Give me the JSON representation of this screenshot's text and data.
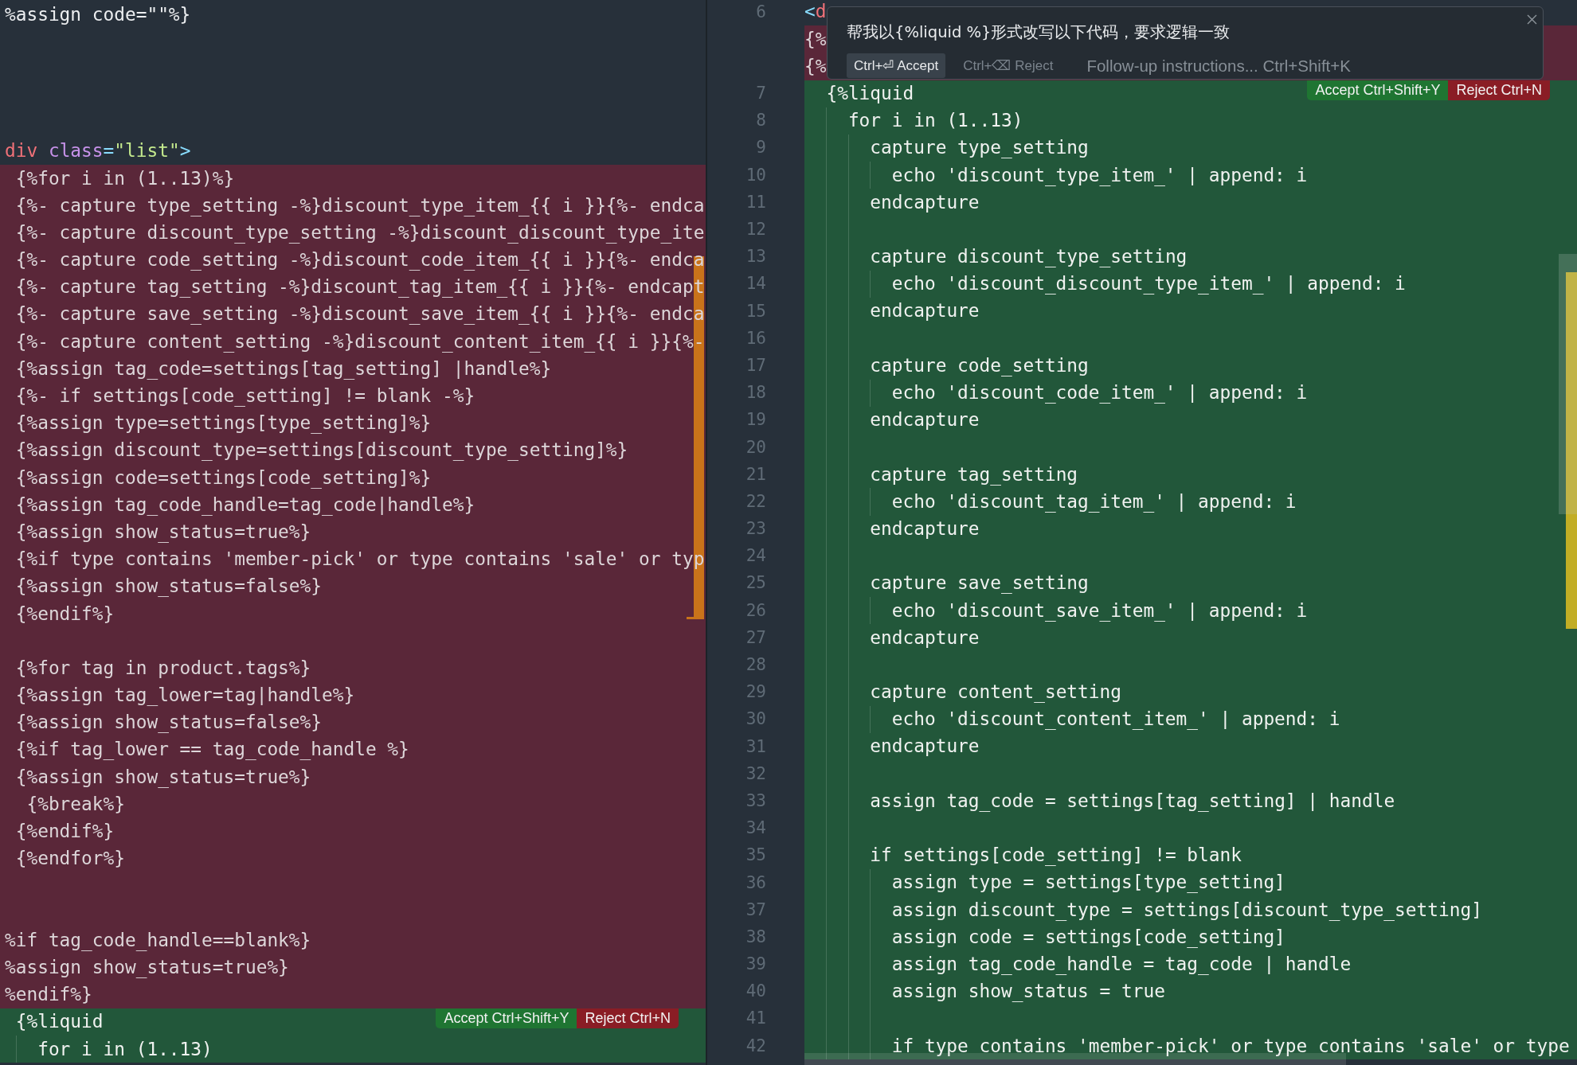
{
  "left_editor": {
    "lines": [
      {
        "kind": "context",
        "text": "%assign code=\"\"%}"
      },
      {
        "kind": "context"
      },
      {
        "kind": "context"
      },
      {
        "kind": "context"
      },
      {
        "kind": "context"
      },
      {
        "kind": "context",
        "tokens": [
          {
            "text": "div",
            "color": "#f07178"
          },
          {
            "text": " class",
            "color": "#c792ea"
          },
          {
            "text": "=",
            "color": "#89ddff"
          },
          {
            "text": "\"list\"",
            "color": "#c3e88d"
          },
          {
            "text": ">",
            "color": "#89ddff"
          }
        ]
      },
      {
        "kind": "removed",
        "text": " {%for i in (1..13)%}"
      },
      {
        "kind": "removed",
        "text": " {%- capture type_setting -%}discount_type_item_{{ i }}{%- endca"
      },
      {
        "kind": "removed",
        "text": " {%- capture discount_type_setting -%}discount_discount_type_ite"
      },
      {
        "kind": "removed",
        "text": " {%- capture code_setting -%}discount_code_item_{{ i }}{%- endca"
      },
      {
        "kind": "removed",
        "text": " {%- capture tag_setting -%}discount_tag_item_{{ i }}{%- endcapt"
      },
      {
        "kind": "removed",
        "text": " {%- capture save_setting -%}discount_save_item_{{ i }}{%- endca"
      },
      {
        "kind": "removed",
        "text": " {%- capture content_setting -%}discount_content_item_{{ i }}{%-"
      },
      {
        "kind": "removed",
        "text": " {%assign tag_code=settings[tag_setting] |handle%}"
      },
      {
        "kind": "removed",
        "text": " {%- if settings[code_setting] != blank -%}"
      },
      {
        "kind": "removed",
        "text": " {%assign type=settings[type_setting]%}"
      },
      {
        "kind": "removed",
        "text": " {%assign discount_type=settings[discount_type_setting]%}"
      },
      {
        "kind": "removed",
        "text": " {%assign code=settings[code_setting]%}"
      },
      {
        "kind": "removed",
        "text": " {%assign tag_code_handle=tag_code|handle%}"
      },
      {
        "kind": "removed",
        "text": " {%assign show_status=true%}"
      },
      {
        "kind": "removed",
        "text": " {%if type contains 'member-pick' or type contains 'sale' or typ"
      },
      {
        "kind": "removed",
        "text": " {%assign show_status=false%}"
      },
      {
        "kind": "removed",
        "text": " {%endif%}"
      },
      {
        "kind": "removed"
      },
      {
        "kind": "removed",
        "text": " {%for tag in product.tags%}"
      },
      {
        "kind": "removed",
        "text": " {%assign tag_lower=tag|handle%}"
      },
      {
        "kind": "removed",
        "text": " {%assign show_status=false%}"
      },
      {
        "kind": "removed",
        "text": " {%if tag_lower == tag_code_handle %}"
      },
      {
        "kind": "removed",
        "text": " {%assign show_status=true%}"
      },
      {
        "kind": "removed",
        "text": "  {%break%}"
      },
      {
        "kind": "removed",
        "text": " {%endif%}"
      },
      {
        "kind": "removed",
        "text": " {%endfor%}"
      },
      {
        "kind": "removed"
      },
      {
        "kind": "removed"
      },
      {
        "kind": "removed",
        "text": "%if tag_code_handle==blank%}"
      },
      {
        "kind": "removed",
        "text": "%assign show_status=true%}"
      },
      {
        "kind": "removed",
        "text": "%endif%}"
      },
      {
        "kind": "added",
        "text": " {%liquid",
        "actions": {
          "accept": "Accept Ctrl+Shift+Y",
          "reject": "Reject Ctrl+N"
        }
      },
      {
        "kind": "added",
        "text": "   for i in (1..13)"
      }
    ]
  },
  "right_editor": {
    "lines": [
      {
        "kind": "context",
        "number": "6",
        "tokens": [
          {
            "text": "<",
            "color": "#89ddff"
          },
          {
            "text": "d",
            "color": "#f07178"
          }
        ]
      },
      {
        "kind": "removed",
        "text": "{%"
      },
      {
        "kind": "removed",
        "text": "{%"
      },
      {
        "kind": "added",
        "number": "7",
        "text": "  {%liquid",
        "actions": {
          "accept": "Accept Ctrl+Shift+Y",
          "reject": "Reject Ctrl+N"
        }
      },
      {
        "kind": "added",
        "number": "8",
        "text": "    for i in (1..13)"
      },
      {
        "kind": "added",
        "number": "9",
        "text": "      capture type_setting"
      },
      {
        "kind": "added",
        "number": "10",
        "text": "        echo 'discount_type_item_' | append: i"
      },
      {
        "kind": "added",
        "number": "11",
        "text": "      endcapture"
      },
      {
        "kind": "added",
        "number": "12"
      },
      {
        "kind": "added",
        "number": "13",
        "text": "      capture discount_type_setting"
      },
      {
        "kind": "added",
        "number": "14",
        "text": "        echo 'discount_discount_type_item_' | append: i"
      },
      {
        "kind": "added",
        "number": "15",
        "text": "      endcapture"
      },
      {
        "kind": "added",
        "number": "16"
      },
      {
        "kind": "added",
        "number": "17",
        "text": "      capture code_setting"
      },
      {
        "kind": "added",
        "number": "18",
        "text": "        echo 'discount_code_item_' | append: i"
      },
      {
        "kind": "added",
        "number": "19",
        "text": "      endcapture"
      },
      {
        "kind": "added",
        "number": "20"
      },
      {
        "kind": "added",
        "number": "21",
        "text": "      capture tag_setting"
      },
      {
        "kind": "added",
        "number": "22",
        "text": "        echo 'discount_tag_item_' | append: i"
      },
      {
        "kind": "added",
        "number": "23",
        "text": "      endcapture"
      },
      {
        "kind": "added",
        "number": "24"
      },
      {
        "kind": "added",
        "number": "25",
        "text": "      capture save_setting"
      },
      {
        "kind": "added",
        "number": "26",
        "text": "        echo 'discount_save_item_' | append: i"
      },
      {
        "kind": "added",
        "number": "27",
        "text": "      endcapture"
      },
      {
        "kind": "added",
        "number": "28"
      },
      {
        "kind": "added",
        "number": "29",
        "text": "      capture content_setting"
      },
      {
        "kind": "added",
        "number": "30",
        "text": "        echo 'discount_content_item_' | append: i"
      },
      {
        "kind": "added",
        "number": "31",
        "text": "      endcapture"
      },
      {
        "kind": "added",
        "number": "32"
      },
      {
        "kind": "added",
        "number": "33",
        "text": "      assign tag_code = settings[tag_setting] | handle"
      },
      {
        "kind": "added",
        "number": "34"
      },
      {
        "kind": "added",
        "number": "35",
        "text": "      if settings[code_setting] != blank"
      },
      {
        "kind": "added",
        "number": "36",
        "text": "        assign type = settings[type_setting]"
      },
      {
        "kind": "added",
        "number": "37",
        "text": "        assign discount_type = settings[discount_type_setting]"
      },
      {
        "kind": "added",
        "number": "38",
        "text": "        assign code = settings[code_setting]"
      },
      {
        "kind": "added",
        "number": "39",
        "text": "        assign tag_code_handle = tag_code | handle"
      },
      {
        "kind": "added",
        "number": "40",
        "text": "        assign show_status = true"
      },
      {
        "kind": "added",
        "number": "41"
      },
      {
        "kind": "added",
        "number": "42",
        "text": "        if type contains 'member-pick' or type contains 'sale' or type"
      }
    ]
  },
  "inline_prompt": {
    "instruction": "帮我以{%liquid %}形式改写以下代码，要求逻辑一致",
    "accept_button": "Ctrl+⏎ Accept",
    "reject_button": "Ctrl+⌫ Reject",
    "follow_up": {
      "placeholder": "Follow-up instructions... Ctrl+Shift+K"
    }
  }
}
